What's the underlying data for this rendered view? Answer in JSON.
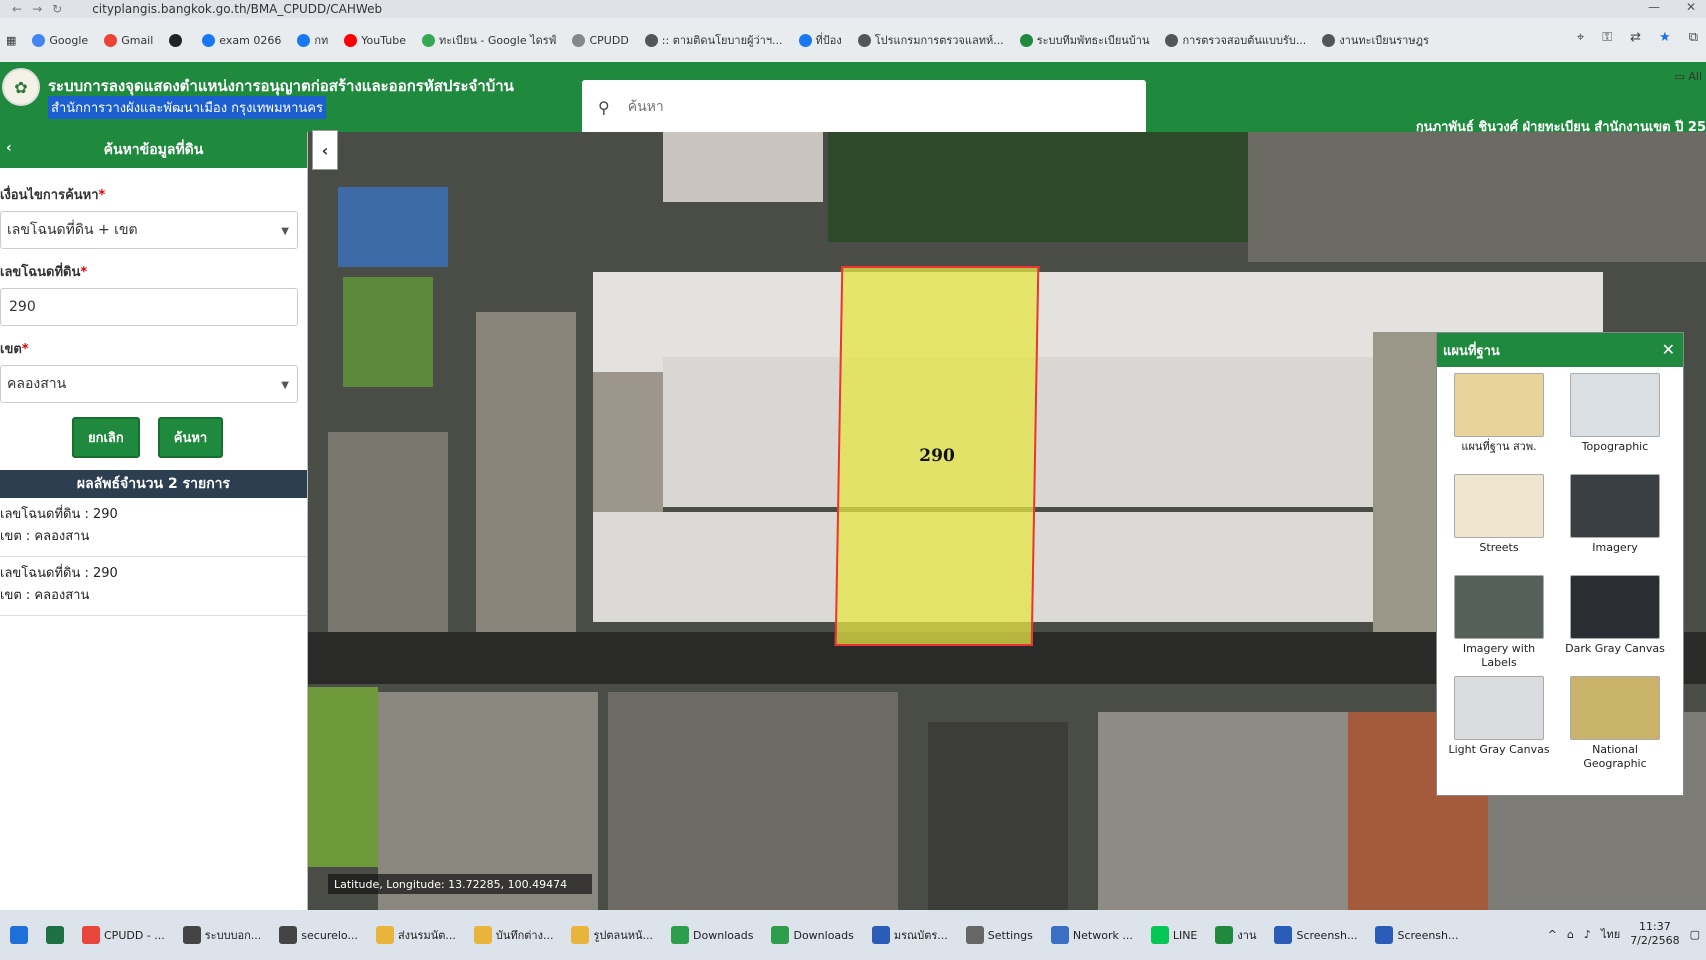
{
  "browser": {
    "url": "cityplangis.bangkok.go.th/BMA_CPUDD/CAHWeb",
    "bookmarks": [
      {
        "label": "Google",
        "color": "#4285f4"
      },
      {
        "label": "Gmail",
        "color": "#ea4335"
      },
      {
        "label": "",
        "color": "#222222"
      },
      {
        "label": "exam 0266",
        "color": "#1877f2"
      },
      {
        "label": "กท",
        "color": "#1877f2"
      },
      {
        "label": "YouTube",
        "color": "#ff0000"
      },
      {
        "label": "ทะเบียน - Google ไดรฟ์",
        "color": "#34a853"
      },
      {
        "label": "CPUDD",
        "color": "#888888"
      },
      {
        "label": ":: ตามติดนโยบายผู้ว่าฯ...",
        "color": "#555555"
      },
      {
        "label": "ที่ป้อง",
        "color": "#1877f2"
      },
      {
        "label": "โปรแกรมการตรวจแลทห์...",
        "color": "#555555"
      },
      {
        "label": "ระบบทีมพัทธะเบียนบ้าน",
        "color": "#1f8a3d"
      },
      {
        "label": "การตรวจสอบต้นแบบรับ...",
        "color": "#555555"
      },
      {
        "label": "งานทะเบียนราษฎร",
        "color": "#555555"
      }
    ],
    "all_bookmarks": "All"
  },
  "app": {
    "title": "ระบบการลงจุดแสดงตำแหน่งการอนุญาตก่อสร้างและออกรหัสประจำบ้าน",
    "subtitle": "สำนักการวางผังและพัฒนาเมือง กรุงเทพมหานคร",
    "search_placeholder": "ค้นหา",
    "user": "กุนภาพันธ์ ชินวงศ์  ฝ่ายทะเบียน สำนักงานเขต ปี 25"
  },
  "panel": {
    "title": "ค้นหาข้อมูลที่ดิน",
    "condition_label": "เงื่อนไขการค้นหา",
    "condition_value": "เลขโฉนดที่ดิน + เขต",
    "deed_label": "เลขโฉนดที่ดิน",
    "deed_value": "290",
    "district_label": "เขต",
    "district_value": "คลองสาน",
    "cancel_label": "ยกเลิก",
    "search_label": "ค้นหา",
    "result_header": "ผลลัพธ์จำนวน 2 รายการ",
    "results": [
      {
        "deed": "เลขโฉนดที่ดิน : 290",
        "district": "เขต : คลองสาน"
      },
      {
        "deed": "เลขโฉนดที่ดิน : 290",
        "district": "เขต : คลองสาน"
      }
    ]
  },
  "map": {
    "parcel_label": "290",
    "coords_text": "Latitude, Longitude: 13.72285, 100.49474"
  },
  "basemap": {
    "title": "แผนที่ฐาน",
    "items": [
      {
        "label": "แผนที่ฐาน สวพ.",
        "color": "#e8d49a"
      },
      {
        "label": "Topographic",
        "color": "#d9dfe3"
      },
      {
        "label": "Streets",
        "color": "#efe6d0"
      },
      {
        "label": "Imagery",
        "color": "#3a3f44"
      },
      {
        "label": "Imagery with Labels",
        "color": "#55605a"
      },
      {
        "label": "Dark Gray Canvas",
        "color": "#2a2d31"
      },
      {
        "label": "Light Gray Canvas",
        "color": "#d9dbde"
      },
      {
        "label": "National Geographic",
        "color": "#c9b36a"
      }
    ]
  },
  "taskbar": {
    "items": [
      {
        "label": "",
        "color": "#1e6fd9"
      },
      {
        "label": "",
        "color": "#1d7044"
      },
      {
        "label": "CPUDD - ...",
        "color": "#e8453c"
      },
      {
        "label": "ระบบบอก...",
        "color": "#444444"
      },
      {
        "label": "securelo...",
        "color": "#444444"
      },
      {
        "label": "ส่งนรมนัต...",
        "color": "#e8b43c"
      },
      {
        "label": "บันทึกต่าง...",
        "color": "#e8b43c"
      },
      {
        "label": "รูปตลนหนั...",
        "color": "#e8b43c"
      },
      {
        "label": "Downloads",
        "color": "#2e9e4c"
      },
      {
        "label": "Downloads",
        "color": "#2e9e4c"
      },
      {
        "label": "มรณบัตร...",
        "color": "#2b5cb8"
      },
      {
        "label": "Settings",
        "color": "#666666"
      },
      {
        "label": "Network ...",
        "color": "#3a6fc4"
      },
      {
        "label": "LINE",
        "color": "#06c755"
      },
      {
        "label": "งาน",
        "color": "#1f8a3d"
      },
      {
        "label": "Screensh...",
        "color": "#2b5cb8"
      },
      {
        "label": "Screensh...",
        "color": "#2b5cb8"
      }
    ],
    "lang": "ไทย",
    "time": "11:37",
    "date": "7/2/2568"
  }
}
